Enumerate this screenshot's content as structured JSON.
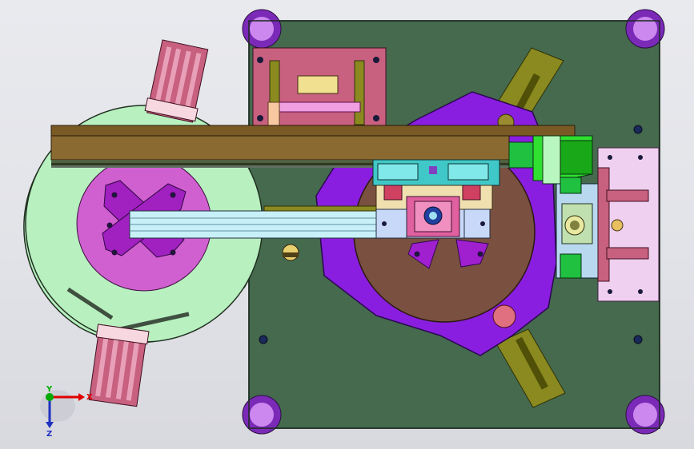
{
  "view": {
    "background_top": "#e9eaee",
    "background_bottom": "#d8d9de"
  },
  "triad": {
    "y_label": "Y",
    "x_label": "X",
    "z_label": "Z",
    "y_color": "#00aa00",
    "x_color": "#e00000",
    "z_color": "#2030c0"
  },
  "colors": {
    "base_plate": "#456a4e",
    "left_disc": "#b8f0c0",
    "center_pad": "#d060d0",
    "rotary_plate": "#8a1ee0",
    "rotary_disc": "#7a5040",
    "rail": "#7a5a24",
    "slide_bar": "#c8f0f8",
    "cylinder_red": "#c86080",
    "foot": "#7b2ab8",
    "side_block": "#f0d0f0",
    "green_block": "#20d020"
  },
  "component_names": [
    "base-plate",
    "left-turntable",
    "suction-pad-cross",
    "rotary-plate",
    "rotary-disc",
    "long-guide-rail",
    "linear-slide-bar",
    "carriage",
    "top-clamp-block",
    "right-stop-block",
    "gripper-cylinder-top",
    "gripper-cylinder-bottom",
    "leveling-foot"
  ]
}
